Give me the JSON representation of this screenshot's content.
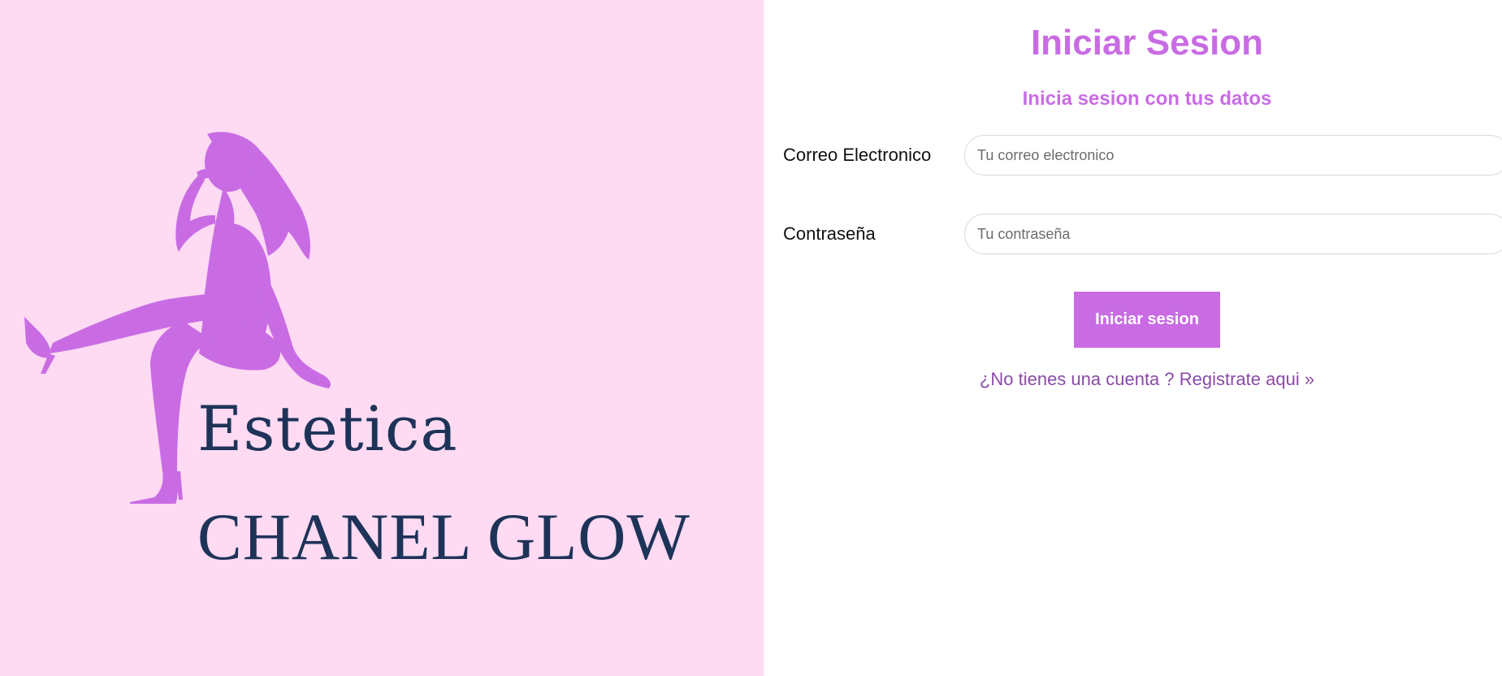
{
  "brand": {
    "logo_line1": "Estetica",
    "logo_line2": "CHANEL GLOW",
    "logo_icon": "woman-silhouette-icon",
    "colors": {
      "background": "#fedaf3",
      "silhouette": "#c96ce4",
      "text": "#1e3358"
    }
  },
  "form": {
    "title": "Iniciar Sesion",
    "subtitle": "Inicia sesion con tus datos",
    "email": {
      "label": "Correo Electronico",
      "placeholder": "Tu correo electronico",
      "value": ""
    },
    "password": {
      "label": "Contraseña",
      "placeholder": "Tu contraseña",
      "value": ""
    },
    "submit_label": "Iniciar sesion",
    "register_link": "¿No tienes una cuenta ? Registrate aqui »",
    "colors": {
      "accent": "#c96ce4",
      "link": "#8b4aa8"
    }
  }
}
